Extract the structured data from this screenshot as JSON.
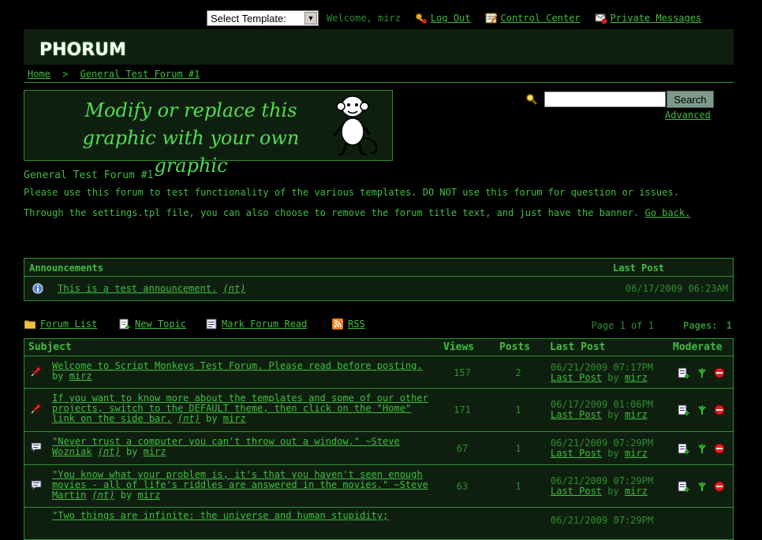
{
  "userbar": {
    "template_select": "Select Template:",
    "welcome": "Welcome, mirz",
    "logout": "Log Out",
    "control_center": "Control Center",
    "private_messages": "Private Messages"
  },
  "header": {
    "logo": "PHORUM"
  },
  "breadcrumb": {
    "home": "Home",
    "separator": ">",
    "forum": "General Test Forum #1"
  },
  "banner": {
    "line1": "Modify or replace this",
    "line2": "graphic with your own graphic"
  },
  "search": {
    "button": "Search",
    "advanced": "Advanced",
    "value": ""
  },
  "forum": {
    "title": "General Test Forum #1",
    "desc1": "Please use this forum to test functionality of the various templates. DO NOT use this forum for question or issues.",
    "desc2": "Through the settings.tpl file, you can also choose to remove the forum title text, and just have the banner.",
    "go_back": "Go back."
  },
  "announcements": {
    "col_title": "Announcements",
    "col_last": "Last Post",
    "items": [
      {
        "title": "This is a test announcement.",
        "tag": "(nt)",
        "date": "06/17/2009 06:23AM"
      }
    ]
  },
  "listnav": {
    "forum_list": "Forum List",
    "new_topic": "New Topic",
    "mark_read": "Mark Forum Read",
    "rss": "RSS",
    "page_info": "Page 1 of 1",
    "pages_label": "Pages:",
    "pages_current": "1"
  },
  "threads": {
    "columns": {
      "subject": "Subject",
      "views": "Views",
      "posts": "Posts",
      "last": "Last Post",
      "moderate": "Moderate"
    },
    "by": "by",
    "last_link": "Last Post",
    "rows": [
      {
        "subject": "Welcome to Script Monkeys Test Forum. Please read before posting.",
        "tag": "",
        "author": "mirz",
        "views": "157",
        "posts": "2",
        "date": "06/21/2009 07:17PM",
        "last_author": "mirz",
        "icon": "pin-icon"
      },
      {
        "subject": "If you want to know more about the templates and some of our other projects, switch to the DEFAULT theme, then click on the \"Home\" link on the side bar.",
        "tag": "(nt)",
        "author": "mirz",
        "views": "171",
        "posts": "1",
        "date": "06/17/2009 01:06PM",
        "last_author": "mirz",
        "icon": "pin-icon"
      },
      {
        "subject": "\"Never trust a computer you can't throw out a window.\" ~Steve Wozniak",
        "tag": "(nt)",
        "author": "mirz",
        "views": "67",
        "posts": "1",
        "date": "06/21/2009 07:29PM",
        "last_author": "mirz",
        "icon": "comment-icon"
      },
      {
        "subject": "\"You know what your problem is, it's that you haven't seen enough movies - all of life's riddles are answered in the movies.\" ~Steve Martin",
        "tag": "(nt)",
        "author": "mirz",
        "views": "63",
        "posts": "1",
        "date": "06/21/2009 07:29PM",
        "last_author": "mirz",
        "icon": "comment-icon"
      },
      {
        "subject": "\"Two things are infinite: the universe and human stupidity;",
        "tag": "",
        "author": "",
        "views": "",
        "posts": "",
        "date": "06/21/2009 07:29PM",
        "last_author": "",
        "icon": "comment-icon"
      }
    ]
  }
}
